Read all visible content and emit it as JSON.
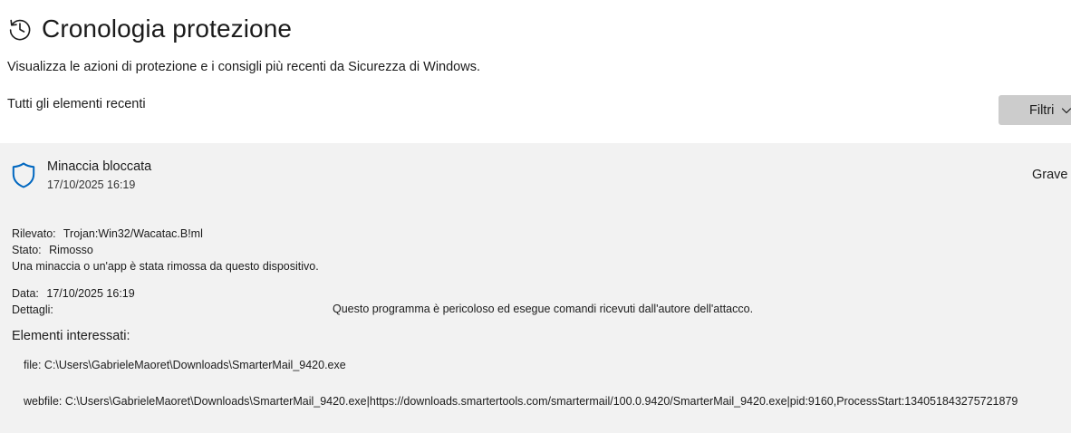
{
  "header": {
    "title": "Cronologia protezione",
    "icon": "history-icon"
  },
  "subtitle": "Visualizza le azioni di protezione e i consigli più recenti da Sicurezza di Windows.",
  "section_label": "Tutti gli elementi recenti",
  "filter_button": {
    "label": "Filtri",
    "icon": "chevron-down-icon"
  },
  "event": {
    "icon": "shield-icon",
    "title": "Minaccia bloccata",
    "date": "17/10/2025 16:19",
    "severity": "Grave",
    "detected_label": "Rilevato:",
    "detected_value": "Trojan:Win32/Wacatac.B!ml",
    "status_label": "Stato:",
    "status_value": "Rimosso",
    "status_message": "Una minaccia o un'app è stata rimossa da questo dispositivo.",
    "date_label": "Data:",
    "date_value": "17/10/2025 16:19",
    "details_label": "Dettagli:",
    "details_value": "Questo programma è pericoloso ed esegue comandi ricevuti dall'autore dell'attacco.",
    "affected_heading": "Elementi interessati:",
    "affected_items": [
      "file: C:\\Users\\GabrieleMaoret\\Downloads\\SmarterMail_9420.exe",
      "webfile: C:\\Users\\GabrieleMaoret\\Downloads\\SmarterMail_9420.exe|https://downloads.smartertools.com/smartermail/100.0.9420/SmarterMail_9420.exe|pid:9160,ProcessStart:134051843275721879"
    ]
  },
  "colors": {
    "card_background": "#f2f2f2",
    "button_background": "#cccccc",
    "shield_accent": "#0067c0",
    "text": "#1b1b1b"
  }
}
